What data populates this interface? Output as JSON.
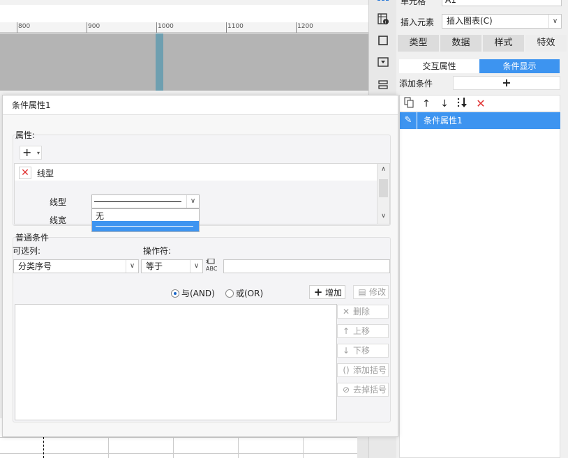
{
  "ruler": {
    "labels": [
      "800",
      "900",
      "1000",
      "1100",
      "1200"
    ]
  },
  "right_panel": {
    "cell_label": "单元格",
    "cell_value": "A1",
    "insert_element_label": "插入元素",
    "insert_element_value": "插入图表(C)",
    "tabs": [
      "类型",
      "数据",
      "样式",
      "特效"
    ],
    "subtabs": [
      "交互属性",
      "条件显示"
    ],
    "add_condition_label": "添加条件",
    "add_symbol": "+",
    "selected_condition": "条件属性1"
  },
  "dialog": {
    "title": "条件属性1",
    "attributes": {
      "group_label": "属性:",
      "add_symbol": "+",
      "property_name": "线型",
      "line_type_label": "线型",
      "line_width_label": "线宽",
      "dropdown_option_none": "无"
    },
    "conditions": {
      "group_label": "普通条件",
      "column_label": "可选列:",
      "column_value": "分类序号",
      "operator_label": "操作符:",
      "operator_value": "等于",
      "abc_text": "ABC",
      "and_label": "与(AND)",
      "or_label": "或(OR)",
      "buttons": {
        "add": "增加",
        "modify": "修改",
        "delete": "删除",
        "move_up": "上移",
        "move_down": "下移",
        "add_bracket": "添加括号",
        "remove_bracket": "去掉括号"
      }
    }
  }
}
